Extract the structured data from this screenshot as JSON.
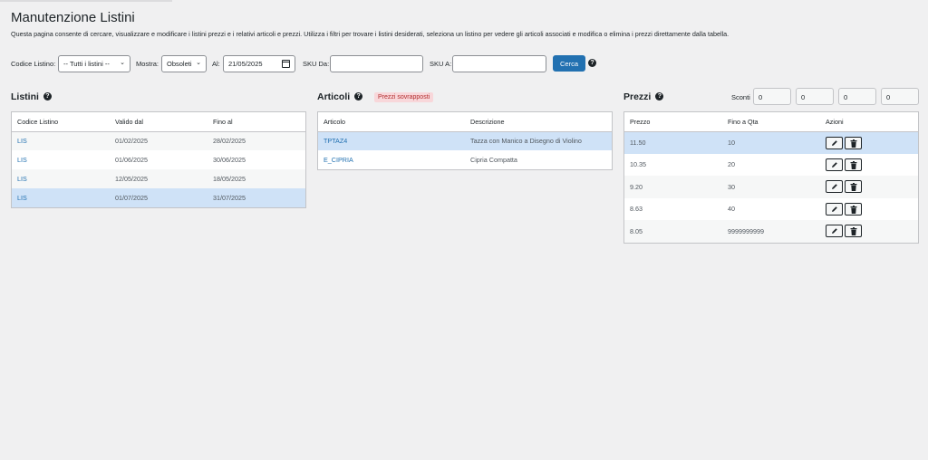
{
  "page": {
    "title": "Manutenzione Listini",
    "description": "Questa pagina consente di cercare, visualizzare e modificare i listini prezzi e i relativi articoli e prezzi. Utilizza i filtri per trovare i listini desiderati, seleziona un listino per vedere gli articoli associati e modifica o elimina i prezzi direttamente dalla tabella."
  },
  "filters": {
    "codice_label": "Codice Listino:",
    "codice_value": "-- Tutti i listini --",
    "mostra_label": "Mostra:",
    "mostra_value": "Obsoleti",
    "al_label": "Al:",
    "al_value": "21/05/2025",
    "sku_da_label": "SKU Da:",
    "sku_da_value": "",
    "sku_a_label": "SKU A:",
    "sku_a_value": "",
    "search_button": "Cerca"
  },
  "listini": {
    "title": "Listini",
    "columns": [
      "Codice Listino",
      "Valido dal",
      "Fino al"
    ],
    "rows": [
      {
        "codice": "LIS",
        "dal": "01/02/2025",
        "al": "28/02/2025"
      },
      {
        "codice": "LIS",
        "dal": "01/06/2025",
        "al": "30/06/2025"
      },
      {
        "codice": "LIS",
        "dal": "12/05/2025",
        "al": "18/05/2025"
      },
      {
        "codice": "LIS",
        "dal": "01/07/2025",
        "al": "31/07/2025"
      }
    ]
  },
  "articoli": {
    "title": "Articoli",
    "badge": "Prezzi sovrapposti",
    "columns": [
      "Articolo",
      "Descrizione"
    ],
    "rows": [
      {
        "articolo": "TPTAZ4",
        "descrizione": "Tazza con Manico a Disegno di Violino"
      },
      {
        "articolo": "E_CIPRIA",
        "descrizione": "Cipria Compatta"
      }
    ]
  },
  "prezzi": {
    "title": "Prezzi",
    "sconti_label": "Sconti",
    "sconti": [
      "0",
      "0",
      "0",
      "0"
    ],
    "columns": [
      "Prezzo",
      "Fino a Qta",
      "Azioni"
    ],
    "rows": [
      {
        "prezzo": "11.50",
        "qta": "10"
      },
      {
        "prezzo": "10.35",
        "qta": "20"
      },
      {
        "prezzo": "9.20",
        "qta": "30"
      },
      {
        "prezzo": "8.63",
        "qta": "40"
      },
      {
        "prezzo": "8.05",
        "qta": "9999999999"
      }
    ]
  },
  "colors": {
    "accent": "#2271b1",
    "selected_row": "#cfe2f7",
    "badge_bg": "#f8d7da",
    "badge_text": "#b32d2e"
  }
}
